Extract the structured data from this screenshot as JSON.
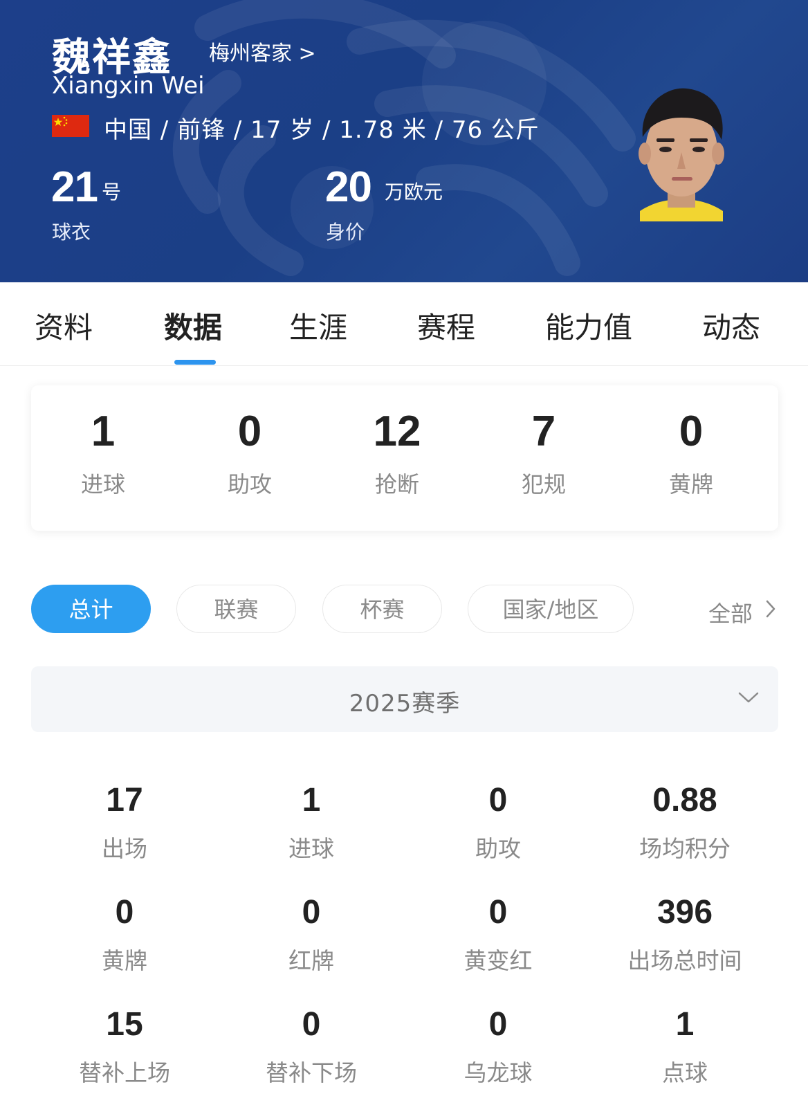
{
  "player": {
    "name": "魏祥鑫",
    "team_link": "梅州客家 >",
    "english_name": "Xiangxin Wei",
    "info_line": "中国 / 前锋 / 17 岁 / 1.78 米 / 76 公斤",
    "flag_icon": "china-flag",
    "jersey_number": "21",
    "jersey_unit": "号",
    "jersey_label": "球衣",
    "market_value": "20",
    "market_value_unit": "万欧元",
    "market_value_label": "身价"
  },
  "tabs": [
    "资料",
    "数据",
    "生涯",
    "赛程",
    "能力值",
    "动态"
  ],
  "active_tab": "数据",
  "summary": [
    {
      "value": "1",
      "label": "进球"
    },
    {
      "value": "0",
      "label": "助攻"
    },
    {
      "value": "12",
      "label": "抢断"
    },
    {
      "value": "7",
      "label": "犯规"
    },
    {
      "value": "0",
      "label": "黄牌"
    }
  ],
  "filters": [
    "总计",
    "联赛",
    "杯赛",
    "国家/地区"
  ],
  "active_filter": "总计",
  "filters_more": "全部",
  "season": {
    "label": "2025赛季"
  },
  "stats": [
    {
      "value": "17",
      "label": "出场"
    },
    {
      "value": "1",
      "label": "进球"
    },
    {
      "value": "0",
      "label": "助攻"
    },
    {
      "value": "0.88",
      "label": "场均积分"
    },
    {
      "value": "0",
      "label": "黄牌"
    },
    {
      "value": "0",
      "label": "红牌"
    },
    {
      "value": "0",
      "label": "黄变红"
    },
    {
      "value": "396",
      "label": "出场总时间"
    },
    {
      "value": "15",
      "label": "替补上场"
    },
    {
      "value": "0",
      "label": "替补下场"
    },
    {
      "value": "0",
      "label": "乌龙球"
    },
    {
      "value": "1",
      "label": "点球"
    }
  ],
  "colors": {
    "header_bg": "#1d3f8a",
    "accent": "#2d9ef0",
    "muted_text": "#8a8a8a"
  }
}
